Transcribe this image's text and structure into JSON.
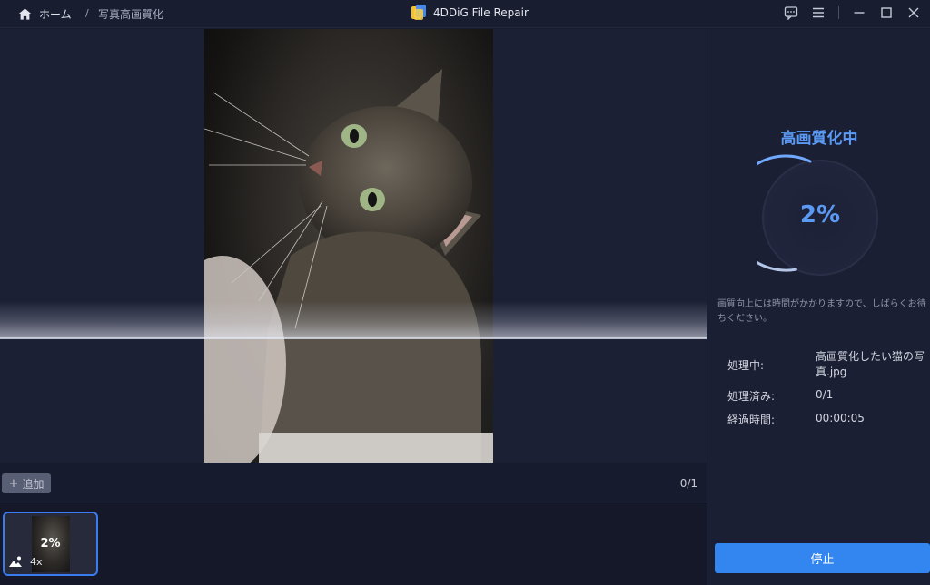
{
  "titlebar": {
    "home_label": "ホーム",
    "breadcrumb_separator": "/",
    "breadcrumb_current": "写真高画質化",
    "app_title": "4DDiG File Repair",
    "icons": [
      "home-icon",
      "app-logo-icon",
      "feedback-icon",
      "menu-icon",
      "minimize-icon",
      "maximize-icon",
      "close-icon"
    ]
  },
  "toolbar": {
    "add_label": "追加",
    "page_count": "0/1"
  },
  "thumbnail": {
    "progress": "2%",
    "scale": "4x",
    "icon": "enhance-image-icon"
  },
  "panel": {
    "status_title": "高画質化中",
    "progress_text": "2%",
    "progress_fraction": 0.02,
    "notice": "画質向上には時間がかかりますので、しばらくお待ちください。",
    "info": [
      {
        "label": "処理中:",
        "value": "高画質化したい猫の写真.jpg"
      },
      {
        "label": "処理済み:",
        "value": "0/1"
      },
      {
        "label": "経過時間:",
        "value": "00:00:05"
      }
    ],
    "stop_label": "停止"
  },
  "colors": {
    "accent": "#3386f0",
    "status_blue": "#5a9af5",
    "background": "#171b2e"
  }
}
